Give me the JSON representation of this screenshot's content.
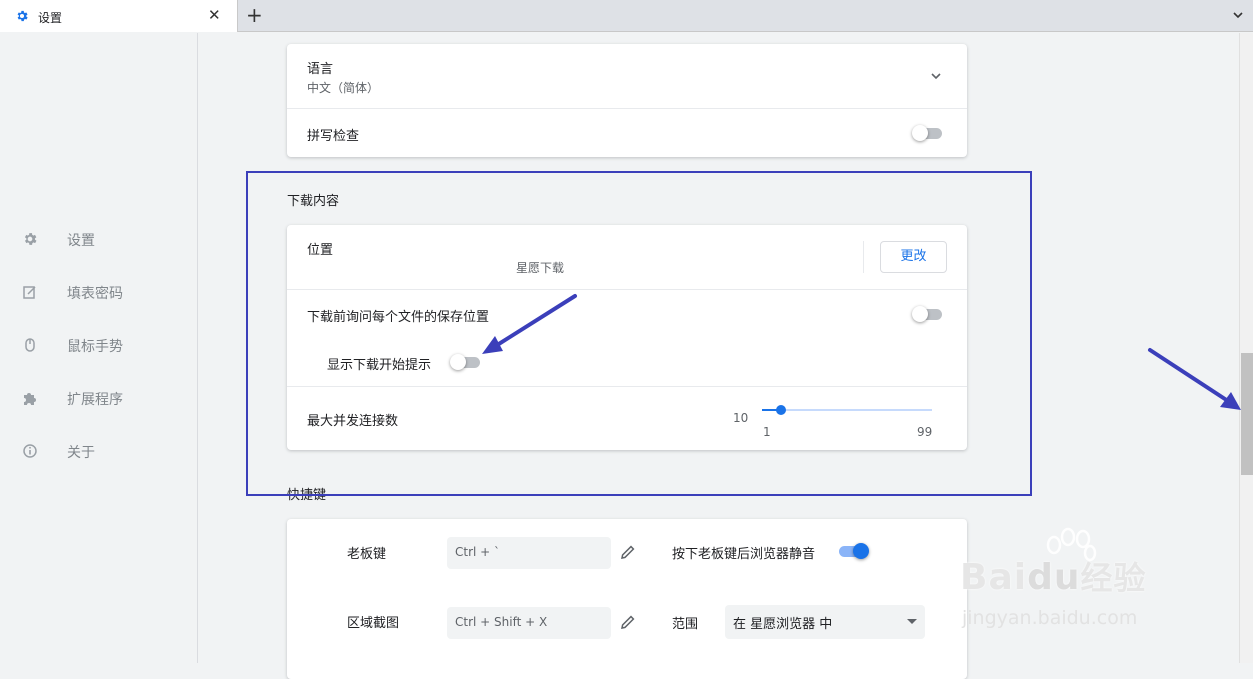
{
  "tabbar": {
    "tab_title": "设置",
    "close_glyph": "✕",
    "new_tab_glyph": "+"
  },
  "sidebar": {
    "items": [
      {
        "label": "设置",
        "icon": "gear-icon"
      },
      {
        "label": "填表密码",
        "icon": "edit-form-icon"
      },
      {
        "label": "鼠标手势",
        "icon": "mouse-icon"
      },
      {
        "label": "扩展程序",
        "icon": "puzzle-icon"
      },
      {
        "label": "关于",
        "icon": "info-icon"
      }
    ]
  },
  "language_card": {
    "language_label": "语言",
    "language_value": "中文（简体）",
    "spellcheck_label": "拼写检查",
    "spellcheck_on": false
  },
  "downloads": {
    "section_title": "下载内容",
    "location_label": "位置",
    "location_value": "星愿下载",
    "change_button": "更改",
    "ask_location_label": "下载前询问每个文件的保存位置",
    "ask_location_on": false,
    "show_prompt_label": "显示下载开始提示",
    "show_prompt_on": false,
    "max_connections_label": "最大并发连接数",
    "max_connections_value": "10",
    "slider_min": "1",
    "slider_max": "99",
    "slider_level": 10
  },
  "shortcuts": {
    "section_title": "快捷键",
    "boss_key_label": "老板键",
    "boss_key_value": "Ctrl + `",
    "mute_label": "按下老板键后浏览器静音",
    "mute_on": true,
    "screenshot_label": "区域截图",
    "screenshot_value": "Ctrl + Shift + X",
    "scope_label": "范围",
    "scope_value": "在 星愿浏览器 中"
  },
  "watermark": {
    "text_brand": "Bai",
    "text_brand2": "du",
    "text_cn": "经验",
    "text_url": "jingyan.baidu.com"
  },
  "colors": {
    "accent": "#1a73e8",
    "annotation": "#3b3fba"
  }
}
